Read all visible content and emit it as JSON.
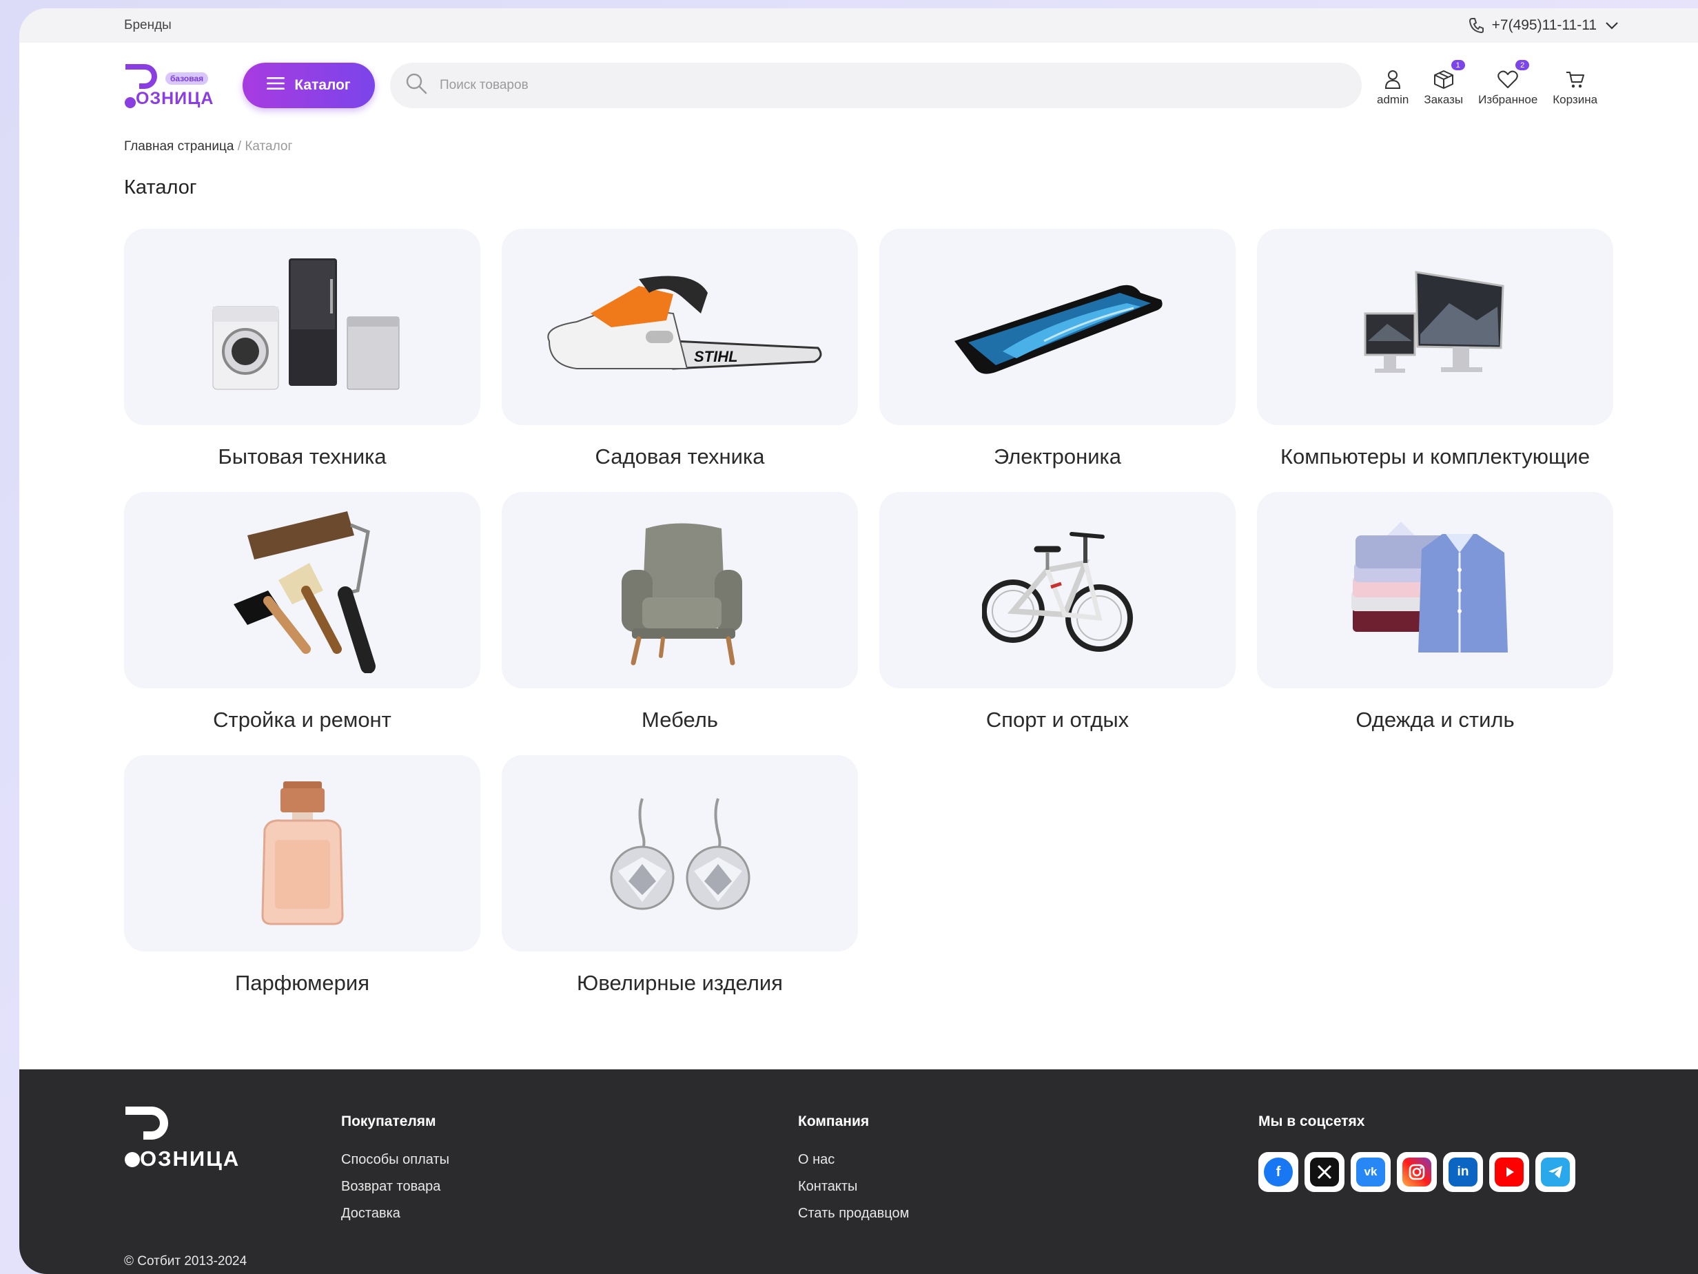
{
  "topbar": {
    "brands_link": "Бренды",
    "phone": "+7(495)11-11-11"
  },
  "header": {
    "logo_word": "ОЗНИЦА",
    "logo_badge": "базовая",
    "catalog_button": "Каталог",
    "search_placeholder": "Поиск товаров",
    "actions": [
      {
        "label": "admin",
        "icon": "user-icon"
      },
      {
        "label": "Заказы",
        "icon": "box-icon",
        "count": "1"
      },
      {
        "label": "Избранное",
        "icon": "heart-icon",
        "count": "2"
      },
      {
        "label": "Корзина",
        "icon": "cart-icon"
      }
    ]
  },
  "breadcrumb": {
    "home": "Главная страница",
    "separator": "/",
    "current": "Каталог"
  },
  "page_title": "Каталог",
  "categories": [
    {
      "label": "Бытовая техника",
      "icon": "appliances-image"
    },
    {
      "label": "Садовая техника",
      "icon": "chainsaw-image"
    },
    {
      "label": "Электроника",
      "icon": "smartphone-image"
    },
    {
      "label": "Компьютеры и комплектующие",
      "icon": "monitors-image"
    },
    {
      "label": "Стройка и ремонт",
      "icon": "paint-tools-image"
    },
    {
      "label": "Мебель",
      "icon": "armchair-image"
    },
    {
      "label": "Спорт и отдых",
      "icon": "bicycle-image"
    },
    {
      "label": "Одежда и стиль",
      "icon": "shirts-image"
    },
    {
      "label": "Парфюмерия",
      "icon": "perfume-image"
    },
    {
      "label": "Ювелирные изделия",
      "icon": "earrings-image"
    }
  ],
  "footer": {
    "logo_word": "ОЗНИЦА",
    "buyers": {
      "title": "Покупателям",
      "links": [
        "Способы оплаты",
        "Возврат товара",
        "Доставка"
      ]
    },
    "company": {
      "title": "Компания",
      "links": [
        "О нас",
        "Контакты",
        "Стать продавцом"
      ]
    },
    "social": {
      "title": "Мы в соцсетях",
      "items": [
        {
          "icon": "facebook-icon",
          "color": "#1877f2"
        },
        {
          "icon": "x-icon",
          "color": "#111111"
        },
        {
          "icon": "vk-icon",
          "color": "#2787f5"
        },
        {
          "icon": "instagram-icon",
          "color": "#d6249f"
        },
        {
          "icon": "linkedin-icon",
          "color": "#0a66c2"
        },
        {
          "icon": "youtube-icon",
          "color": "#ff0000"
        },
        {
          "icon": "telegram-icon",
          "color": "#29a9eb"
        }
      ]
    },
    "copyright": "© Сотбит 2013-2024"
  },
  "colors": {
    "accent_start": "#a83be0",
    "accent_end": "#7b45ea",
    "footer_bg": "#2b2b2d",
    "card_bg": "#f4f5fa"
  }
}
